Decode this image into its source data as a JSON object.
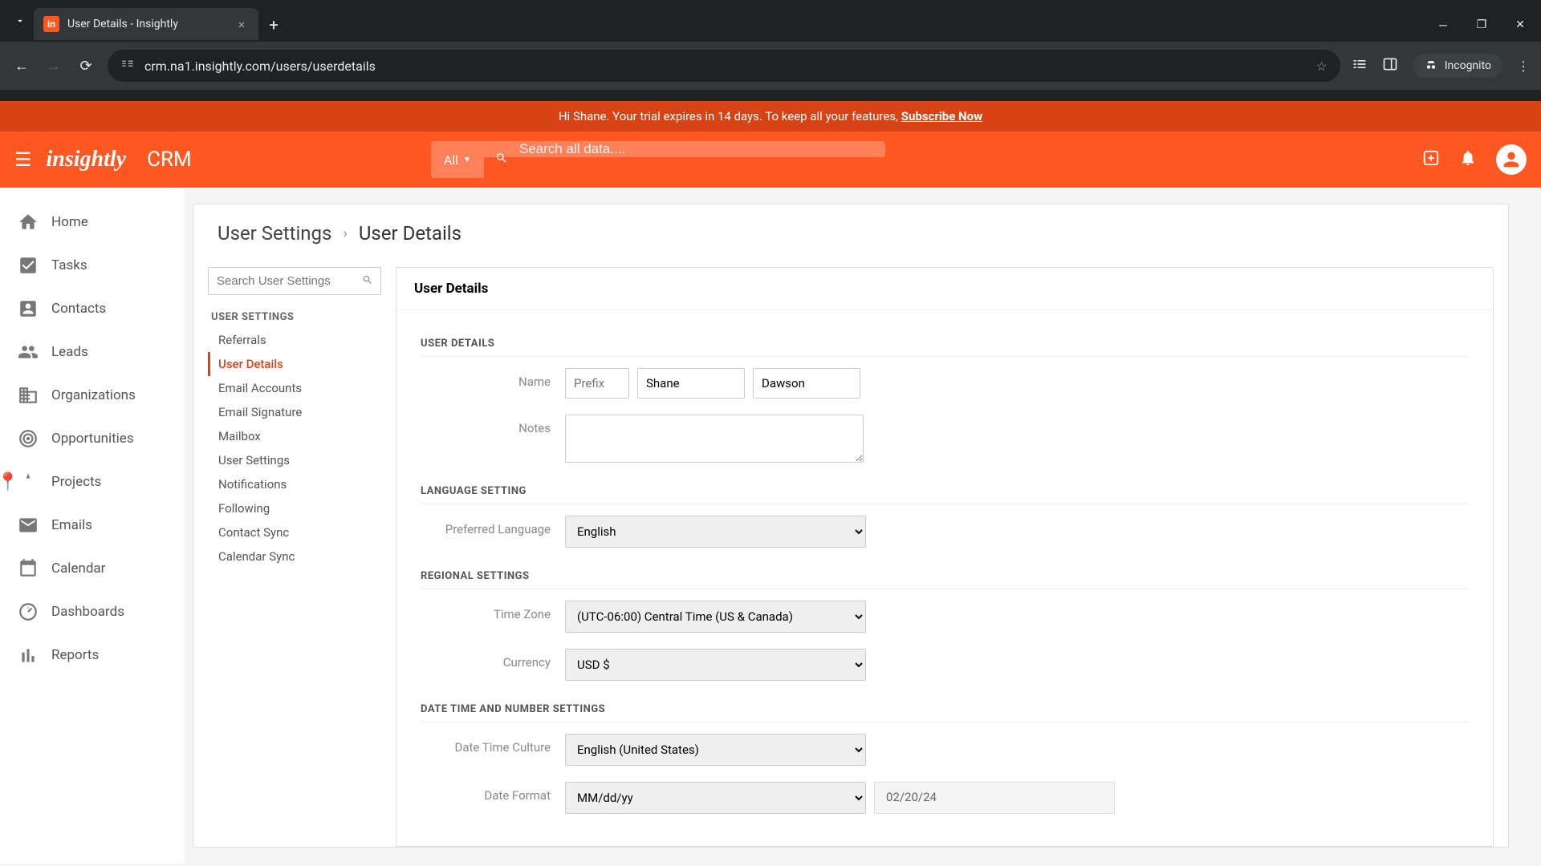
{
  "browser": {
    "tab_title": "User Details - Insightly",
    "url": "crm.na1.insightly.com/users/userdetails",
    "incognito_label": "Incognito"
  },
  "banner": {
    "text_prefix": "Hi Shane. Your trial expires in 14 days. To keep all your features, ",
    "subscribe_label": "Subscribe Now"
  },
  "header": {
    "logo_text": "insightly",
    "app_name": "CRM",
    "search_scope": "All",
    "search_placeholder": "Search all data...."
  },
  "main_nav": [
    {
      "label": "Home"
    },
    {
      "label": "Tasks"
    },
    {
      "label": "Contacts"
    },
    {
      "label": "Leads"
    },
    {
      "label": "Organizations"
    },
    {
      "label": "Opportunities"
    },
    {
      "label": "Projects"
    },
    {
      "label": "Emails"
    },
    {
      "label": "Calendar"
    },
    {
      "label": "Dashboards"
    },
    {
      "label": "Reports"
    }
  ],
  "breadcrumb": {
    "parent": "User Settings",
    "current": "User Details"
  },
  "settings_nav": {
    "search_placeholder": "Search User Settings",
    "heading": "USER SETTINGS",
    "items": [
      {
        "label": "Referrals"
      },
      {
        "label": "User Details",
        "active": true
      },
      {
        "label": "Email Accounts"
      },
      {
        "label": "Email Signature"
      },
      {
        "label": "Mailbox"
      },
      {
        "label": "User Settings"
      },
      {
        "label": "Notifications"
      },
      {
        "label": "Following"
      },
      {
        "label": "Contact Sync"
      },
      {
        "label": "Calendar Sync"
      }
    ]
  },
  "panel": {
    "title": "User Details",
    "sections": {
      "user_details": {
        "heading": "USER DETAILS",
        "name_label": "Name",
        "prefix_placeholder": "Prefix",
        "first_name": "Shane",
        "last_name": "Dawson",
        "notes_label": "Notes",
        "notes_value": ""
      },
      "language": {
        "heading": "LANGUAGE SETTING",
        "pref_lang_label": "Preferred Language",
        "pref_lang_value": "English"
      },
      "regional": {
        "heading": "REGIONAL SETTINGS",
        "tz_label": "Time Zone",
        "tz_value": "(UTC-06:00) Central Time (US & Canada)",
        "currency_label": "Currency",
        "currency_value": "USD $"
      },
      "datetime": {
        "heading": "DATE TIME AND NUMBER SETTINGS",
        "culture_label": "Date Time Culture",
        "culture_value": "English (United States)",
        "dateformat_label": "Date Format",
        "dateformat_value": "MM/dd/yy",
        "dateformat_sample": "02/20/24"
      }
    }
  }
}
